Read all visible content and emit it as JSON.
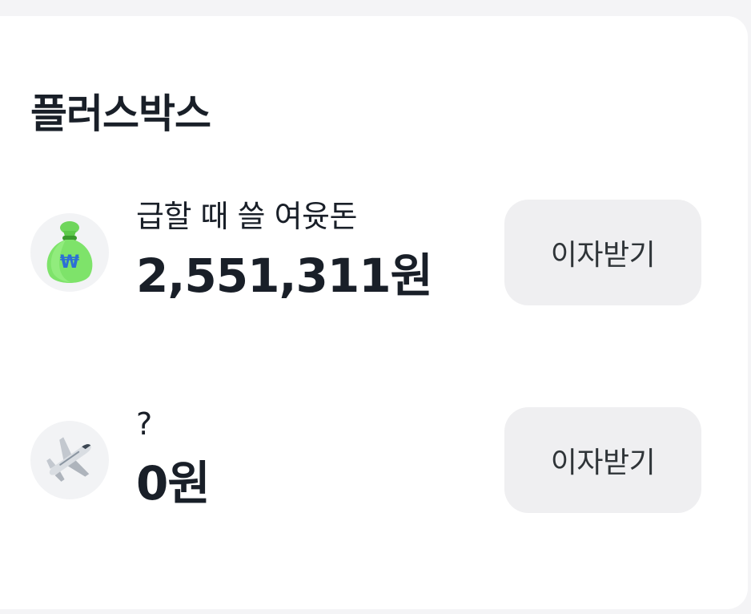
{
  "plusbox": {
    "title": "플러스박스",
    "accounts": [
      {
        "icon": "money-bag-icon",
        "label": "급할 때 쓸 여윳돈",
        "amount": "2,551,311원",
        "action_label": "이자받기"
      },
      {
        "icon": "airplane-icon",
        "label": "?",
        "amount": "0원",
        "action_label": "이자받기"
      }
    ]
  },
  "colors": {
    "background": "#f4f4f6",
    "card": "#ffffff",
    "button": "#efeff1",
    "text": "#191f28",
    "money_bag": "#7ee36a",
    "won_sign": "#2d6fd6"
  }
}
